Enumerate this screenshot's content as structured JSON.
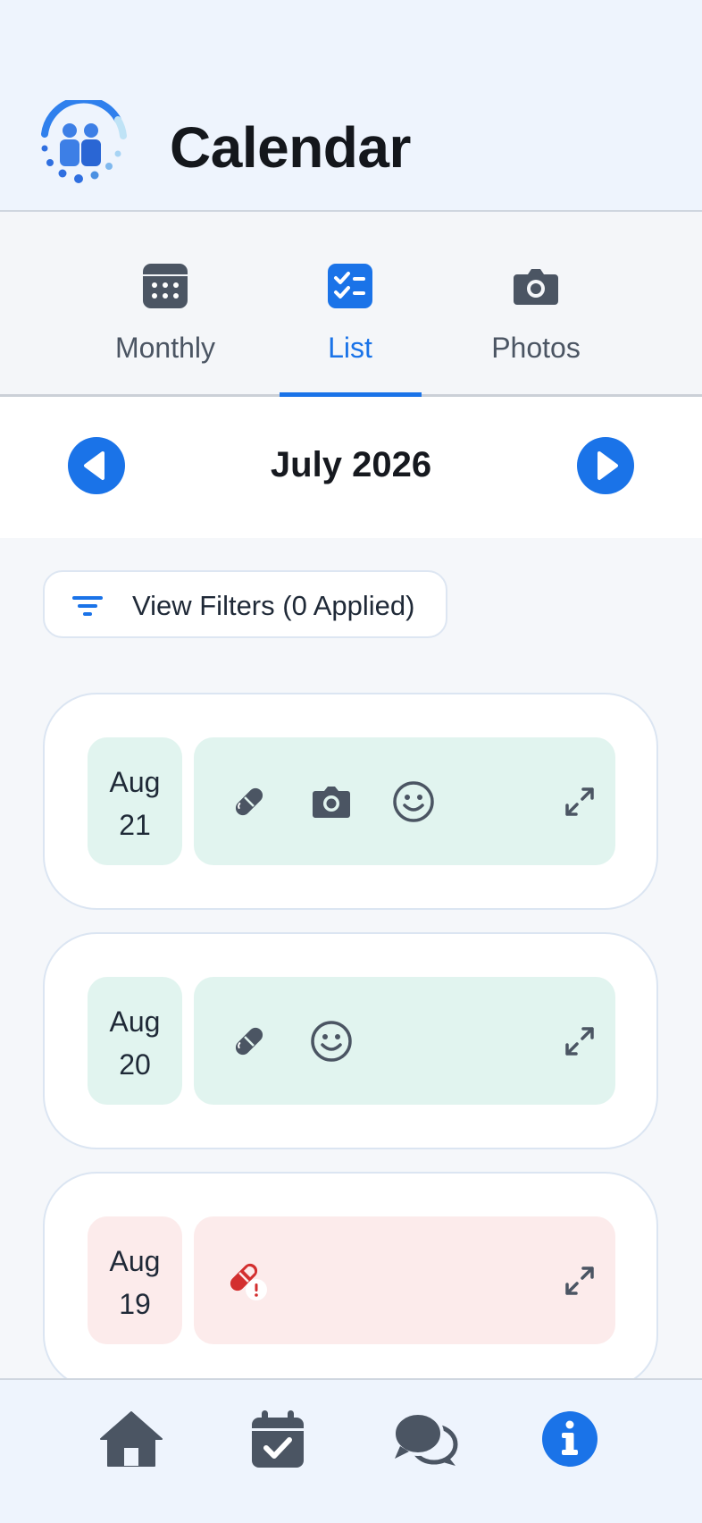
{
  "header": {
    "title": "Calendar",
    "logo": "family-logo-icon"
  },
  "tabs": [
    {
      "label": "Monthly",
      "icon": "calendar-grid-icon",
      "active": false
    },
    {
      "label": "List",
      "icon": "checklist-icon",
      "active": true
    },
    {
      "label": "Photos",
      "icon": "camera-icon",
      "active": false
    }
  ],
  "month_nav": {
    "title": "July 2026",
    "prev_icon": "chevron-left-icon",
    "next_icon": "chevron-right-icon"
  },
  "filters": {
    "label": "View Filters (0 Applied)",
    "icon": "filter-icon"
  },
  "entries": [
    {
      "month": "Aug",
      "day": "21",
      "status": "ok",
      "icons": [
        "pill-icon",
        "camera-icon",
        "smile-icon"
      ]
    },
    {
      "month": "Aug",
      "day": "20",
      "status": "ok",
      "icons": [
        "pill-icon",
        "smile-icon"
      ]
    },
    {
      "month": "Aug",
      "day": "19",
      "status": "alert",
      "icons": [
        "pill-alert-icon"
      ]
    }
  ],
  "bottom_nav": [
    "home-icon",
    "calendar-check-icon",
    "chat-icon",
    "info-icon"
  ],
  "colors": {
    "accent": "#1a73e8",
    "ok_bg": "#e1f4ef",
    "alert_bg": "#fcebeb",
    "alert": "#d32f2f",
    "icon": "#4b5563"
  }
}
